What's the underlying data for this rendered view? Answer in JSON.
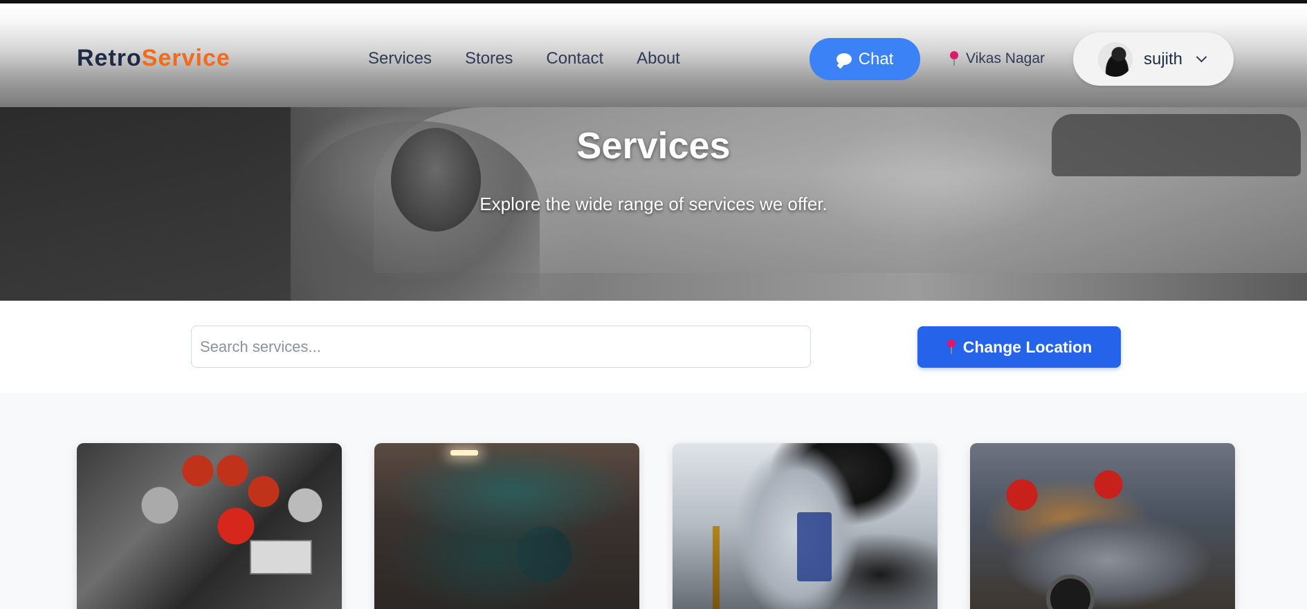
{
  "brand": {
    "retro": "Retro",
    "service": "Service"
  },
  "nav": [
    {
      "label": "Services"
    },
    {
      "label": "Stores"
    },
    {
      "label": "Contact"
    },
    {
      "label": "About"
    }
  ],
  "chat": {
    "label": "Chat",
    "icon": "chat-bubble-icon"
  },
  "location": {
    "label": "Vikas Nagar",
    "icon": "map-pin-icon"
  },
  "user": {
    "name": "sujith",
    "icon": "chevron-down-icon"
  },
  "hero": {
    "title": "Services",
    "subtitle": "Explore the wide range of services we offer."
  },
  "search": {
    "placeholder": "Search services...",
    "value": ""
  },
  "change_location": {
    "label": "Change Location",
    "icon": "map-pin-icon"
  },
  "colors": {
    "accent": "#3b82f6",
    "primary_button": "#2563eb",
    "brand_orange": "#f26a1b",
    "brand_dark": "#1f2a44",
    "pin": "#e0176b"
  }
}
